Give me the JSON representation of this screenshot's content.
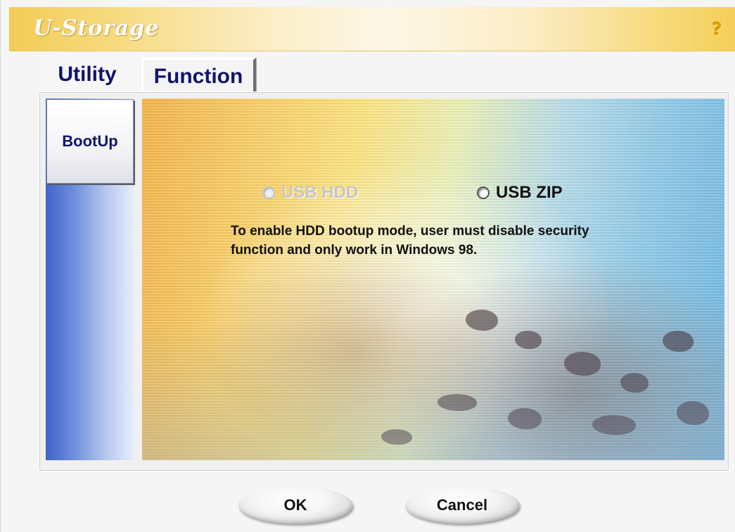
{
  "window": {
    "title": "U-Storage",
    "help_icon": "help-question-icon",
    "title_gradient_color": "#f2cc56"
  },
  "tabs": [
    {
      "label": "Utility",
      "selected": true
    },
    {
      "label": "Function",
      "selected": false
    }
  ],
  "sidebar": {
    "items": [
      {
        "label": "BootUp",
        "selected": true
      }
    ],
    "gradient_color": "#3f63c9"
  },
  "bootup": {
    "options": [
      {
        "label": "USB HDD",
        "enabled": false,
        "selected": false
      },
      {
        "label": "USB ZIP",
        "enabled": true,
        "selected": false
      }
    ],
    "note": "To enable HDD bootup mode, user must disable security function and only work in Windows 98."
  },
  "buttons": {
    "ok_label": "OK",
    "cancel_label": "Cancel"
  },
  "colors": {
    "label_text": "#13146a",
    "disabled_text": "#c7c7c7"
  }
}
